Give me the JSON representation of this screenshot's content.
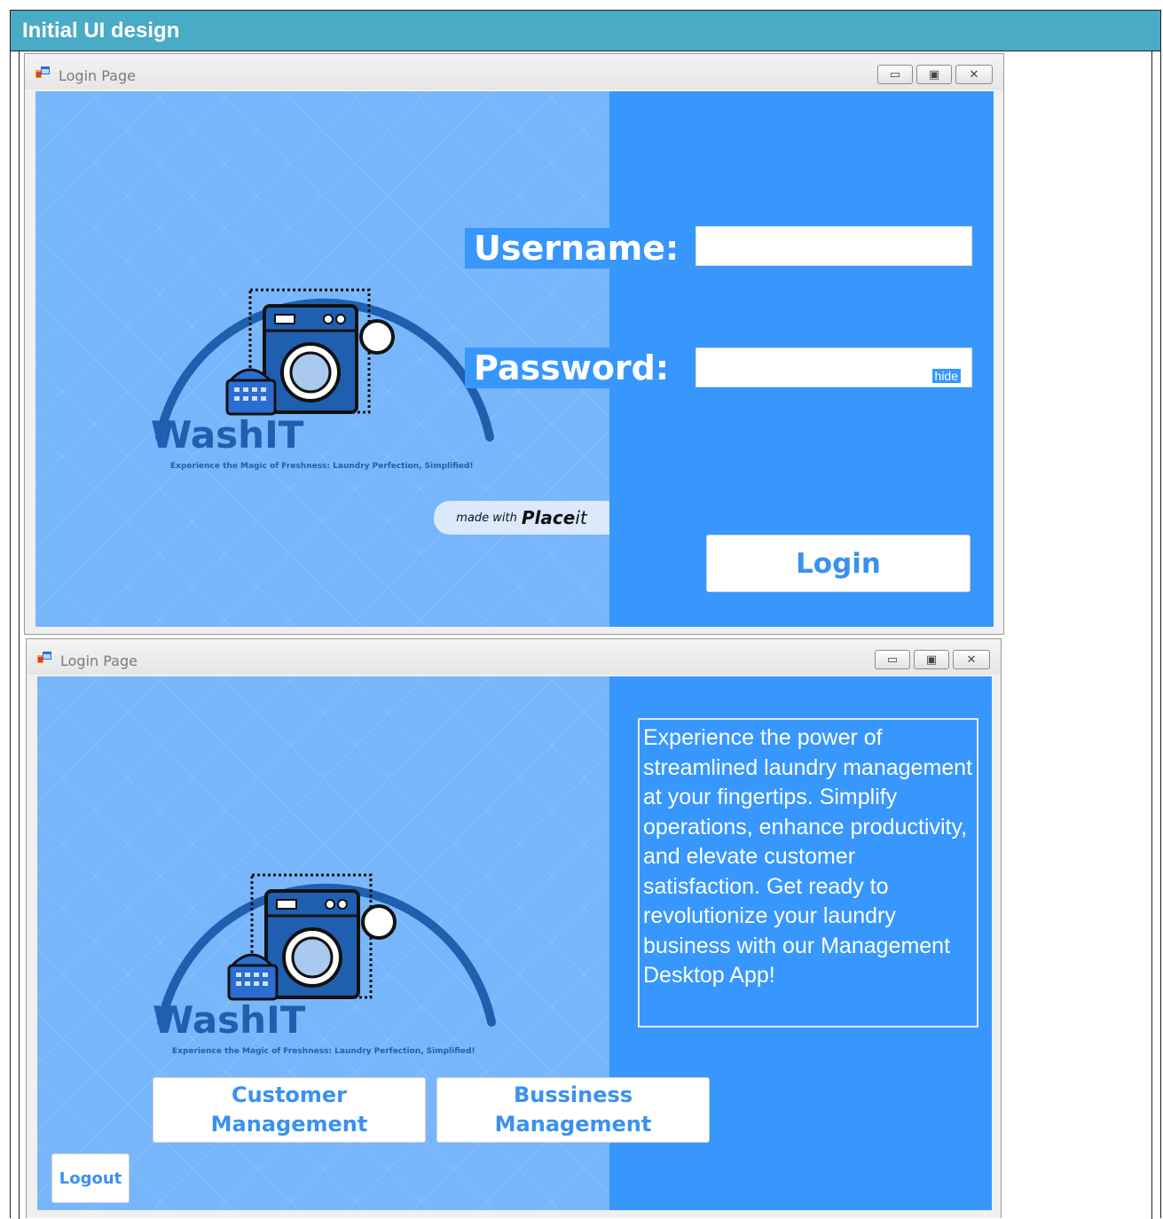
{
  "document": {
    "header_title": "Initial UI design"
  },
  "windows": [
    {
      "title": "Login Page",
      "controls": {
        "minimize": "▭",
        "maximize": "▣",
        "close": "✕"
      },
      "logo": {
        "name": "WashIT",
        "tagline": "Experience the Magic of Freshness: Laundry Perfection, Simplified!"
      },
      "made_with": {
        "prefix": "made with",
        "brand_bold": "Place",
        "brand_italic": "it"
      },
      "username_label": "Username:",
      "password_label": "Password:",
      "username_value": "",
      "password_value": "",
      "hide_label": "hide",
      "login_button": "Login"
    },
    {
      "title": "Login Page",
      "controls": {
        "minimize": "▭",
        "maximize": "▣",
        "close": "✕"
      },
      "logo": {
        "name": "WashIT",
        "tagline": "Experience the Magic of Freshness: Laundry Perfection, Simplified!"
      },
      "description": "Experience the power of streamlined laundry management at your fingertips. Simplify operations, enhance productivity, and elevate customer satisfaction. Get ready to revolutionize your laundry business with our Management Desktop App!",
      "customer_button": "Customer Management",
      "business_button": "Bussiness Management",
      "logout_button": "Logout"
    }
  ],
  "colors": {
    "header": "#4aabc6",
    "left_pane": "#78b6fb",
    "right_pane": "#3797fd",
    "logo_blue": "#1f5fb0",
    "button_text": "#3a91ef"
  }
}
